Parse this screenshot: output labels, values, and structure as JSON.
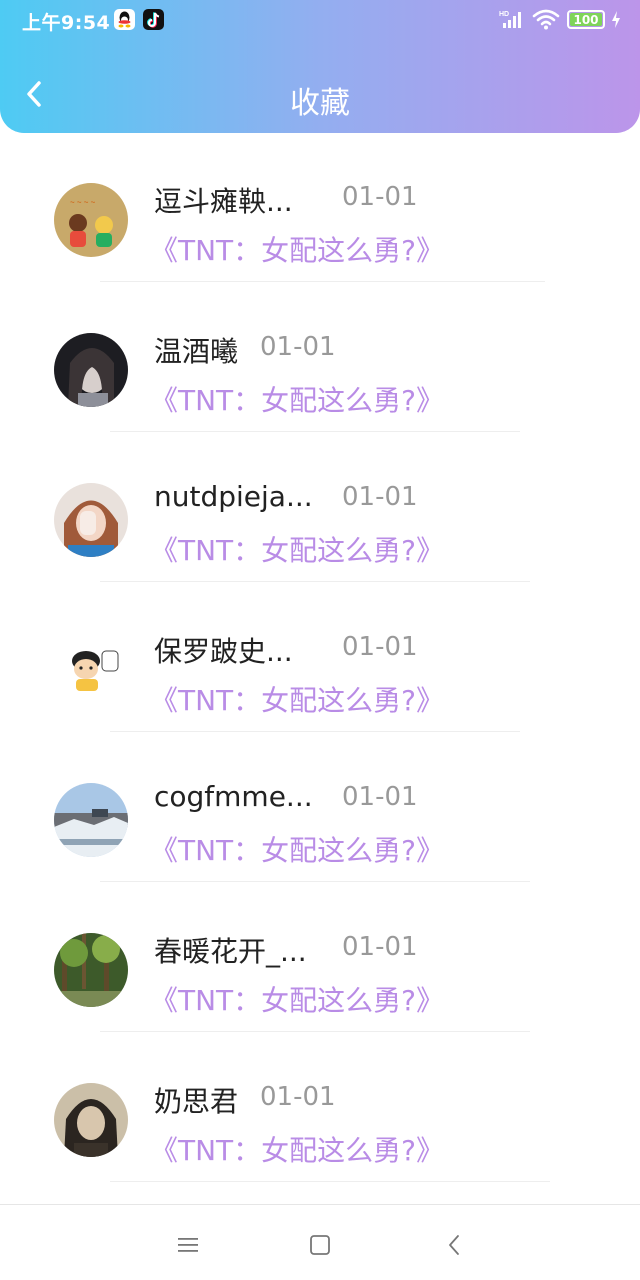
{
  "status_bar": {
    "time": "上午9:54",
    "network_label": "HD",
    "battery_level": "100"
  },
  "header": {
    "title": "收藏"
  },
  "items": [
    {
      "name": "逗斗瘫鞅...",
      "date": "01-01",
      "work": "《TNT：女配这么勇?》"
    },
    {
      "name": "温酒曦",
      "date": "01-01",
      "work": "《TNT：女配这么勇?》"
    },
    {
      "name": "nutdpieja...",
      "date": "01-01",
      "work": "《TNT：女配这么勇?》"
    },
    {
      "name": "保罗跛史...",
      "date": "01-01",
      "work": "《TNT：女配这么勇?》"
    },
    {
      "name": "cogfmme...",
      "date": "01-01",
      "work": "《TNT：女配这么勇?》"
    },
    {
      "name": "春暖花开_...",
      "date": "01-01",
      "work": "《TNT：女配这么勇?》"
    },
    {
      "name": "奶思君",
      "date": "01-01",
      "work": "《TNT：女配这么勇?》"
    }
  ],
  "nav": {
    "menu": "menu-icon",
    "home": "square-icon",
    "back": "back-arrow-icon"
  },
  "colors": {
    "gradient_start": "#4ecbf3",
    "gradient_end": "#bc95ea",
    "work_title": "#b98ce6",
    "date": "#999999"
  }
}
